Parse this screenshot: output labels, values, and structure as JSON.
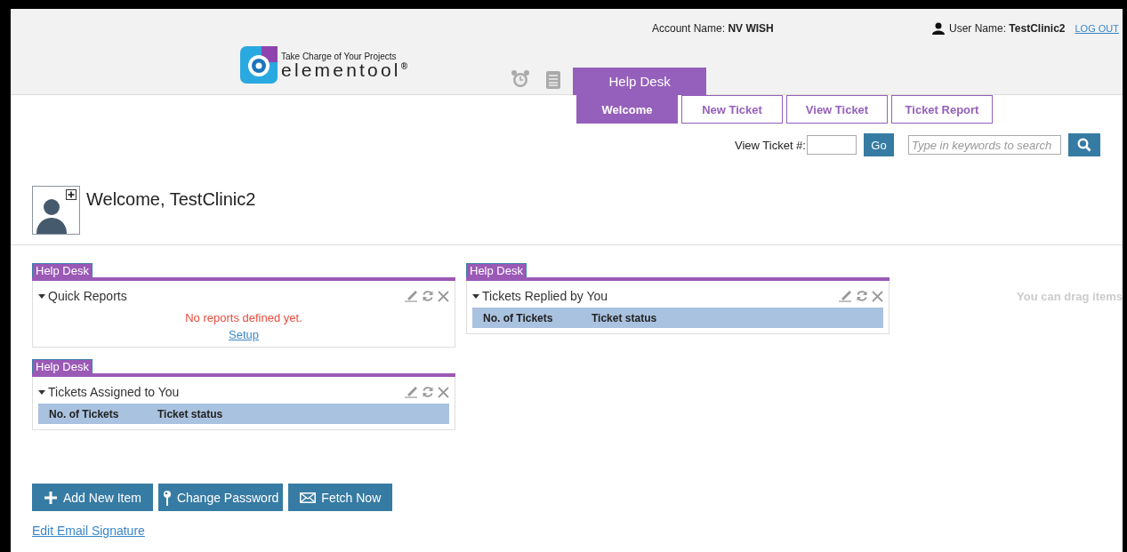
{
  "header": {
    "account_label": "Account Name:",
    "account_value": "NV WISH",
    "user_label": "User Name:",
    "user_value": "TestClinic2",
    "logout": "LOG OUT"
  },
  "logo": {
    "tagline": "Take Charge of Your Projects",
    "name": "elementool",
    "mark": "®"
  },
  "module_tab": "Help Desk",
  "tabs": [
    {
      "label": "Welcome",
      "selected": true
    },
    {
      "label": "New Ticket",
      "selected": false
    },
    {
      "label": "View Ticket",
      "selected": false
    },
    {
      "label": "Ticket Report",
      "selected": false
    }
  ],
  "ticket_lookup": {
    "label": "View Ticket #:",
    "button": "Go"
  },
  "search": {
    "placeholder": "Type in keywords to search"
  },
  "welcome": "Welcome, TestClinic2",
  "columns": [
    [
      {
        "category": "Help Desk",
        "title": "Quick Reports",
        "kind": "message",
        "message": "No reports defined yet.",
        "link": "Setup"
      },
      {
        "category": "Help Desk",
        "title": "Tickets Assigned to You",
        "kind": "table",
        "headers": [
          "No. of Tickets",
          "Ticket status"
        ]
      }
    ],
    [
      {
        "category": "Help Desk",
        "title": "Tickets Replied by You",
        "kind": "table",
        "headers": [
          "No. of Tickets",
          "Ticket status"
        ]
      }
    ]
  ],
  "drag_hint": "You can drag items",
  "buttons": [
    {
      "label": "Add New Item",
      "kind": "add"
    },
    {
      "label": "Change Password",
      "kind": "pin"
    },
    {
      "label": "Fetch Now",
      "kind": "mail"
    }
  ],
  "signature_link": "Edit Email Signature"
}
